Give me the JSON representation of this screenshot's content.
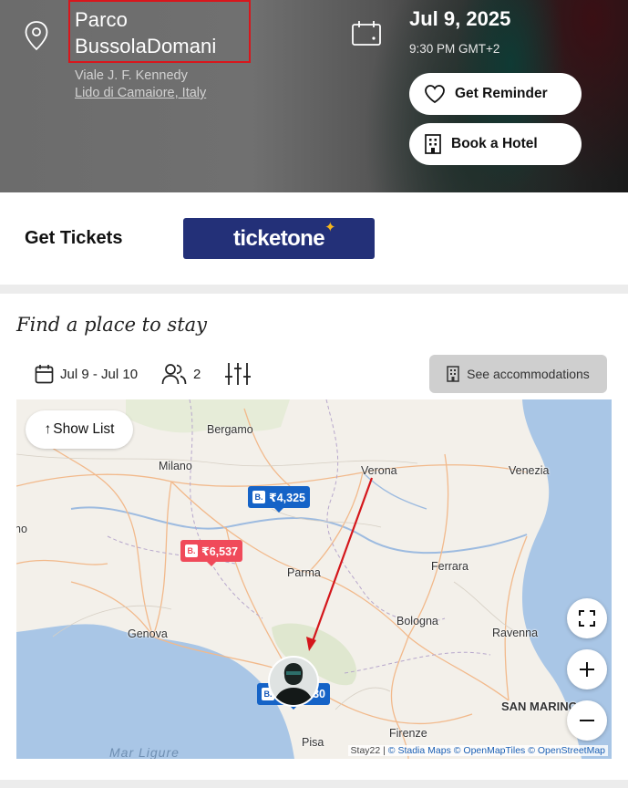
{
  "venue": {
    "name": "Parco BussolaDomani",
    "street": "Viale J. F. Kennedy",
    "city": "Lido di Camaiore, Italy"
  },
  "event": {
    "date": "Jul 9, 2025",
    "time": "9:30 PM GMT+2"
  },
  "actions": {
    "reminder": "Get Reminder",
    "hotel": "Book a Hotel"
  },
  "tickets": {
    "label": "Get Tickets",
    "provider": "ticketone"
  },
  "stay": {
    "title": "Find a place to stay",
    "dates": "Jul 9 - Jul 10",
    "guests": "2",
    "see_accommodations": "See accommodations"
  },
  "map": {
    "show_list": "Show List",
    "cities": {
      "bergamo": "Bergamo",
      "milano": "Milano",
      "verona": "Verona",
      "venezia": "Venezia",
      "parma": "Parma",
      "ferrara": "Ferrara",
      "genova": "Genova",
      "bologna": "Bologna",
      "ravenna": "Ravenna",
      "firenze": "Firenze",
      "pisa": "Pisa",
      "san_marino": "SAN MARINO",
      "left_edge": "no"
    },
    "sea": "Mar Ligure",
    "prices": {
      "verona_area": "₹4,325",
      "milano_area": "₹6,537",
      "coast": "30"
    },
    "attribution": {
      "prefix": "Stay22 |",
      "stadia": "© Stadia Maps",
      "omt": "© OpenMapTiles",
      "osm": "© OpenStreetMap"
    }
  },
  "colors": {
    "ticket_button": "#233078",
    "booking_blue": "#1563c7",
    "price_red": "#f04a5a",
    "highlight_red": "#d8161c",
    "sea": "#a9c6e6"
  }
}
